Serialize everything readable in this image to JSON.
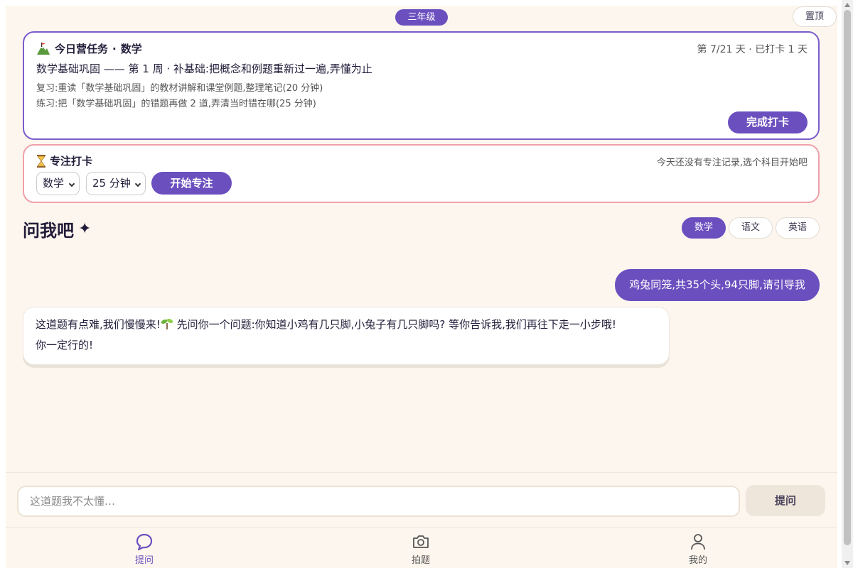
{
  "header": {
    "grade": "三年级",
    "pin_label": "置顶"
  },
  "task": {
    "emoji": "⛰",
    "heading": "今日营任务",
    "subject": "数学",
    "progress": "第 7/21 天 · 已打卡 1 天",
    "title": "数学基础巩固 —— 第 1 周 · 补基础:把概念和例题重新过一遍,弄懂为止",
    "line1": "复习:重读「数学基础巩固」的教材讲解和课堂例题,整理笔记(20 分钟)",
    "line2": "练习:把「数学基础巩固」的错题再做 2 道,弄清当时错在哪(25 分钟)",
    "done_label": "完成打卡"
  },
  "focus": {
    "icon": "hourglass-icon",
    "heading": "专注打卡",
    "note": "今天还没有专注记录,选个科目开始吧",
    "subject_value": "数学",
    "minutes_value": "25 分钟",
    "start_label": "开始专注"
  },
  "ask": {
    "title": "问我吧",
    "sparkle": "✦",
    "chips": [
      "数学",
      "语文",
      "英语"
    ],
    "active_chip": "数学"
  },
  "chat": {
    "user_message": "鸡兔同笼,共35个头,94只脚,请引导我",
    "bot_message_part1": "这道题有点难,我们慢慢来!",
    "bot_message_part2": " 先问你一个问题:你知道小鸡有几只脚,小兔子有几只脚吗? 等你告诉我,我们再往下走一小步哦!",
    "bot_message_part3": "你一定行的!"
  },
  "composer": {
    "placeholder": "这道题我不太懂…",
    "submit_label": "提问"
  },
  "nav": [
    {
      "label": "提问",
      "icon": "chat-bubble-icon"
    },
    {
      "label": "拍题",
      "icon": "camera-icon"
    },
    {
      "label": "我的",
      "icon": "user-icon"
    }
  ],
  "colors": {
    "accent": "#6b4fbf",
    "focus_border": "#f0a0aa",
    "background": "#fdf6ee"
  }
}
